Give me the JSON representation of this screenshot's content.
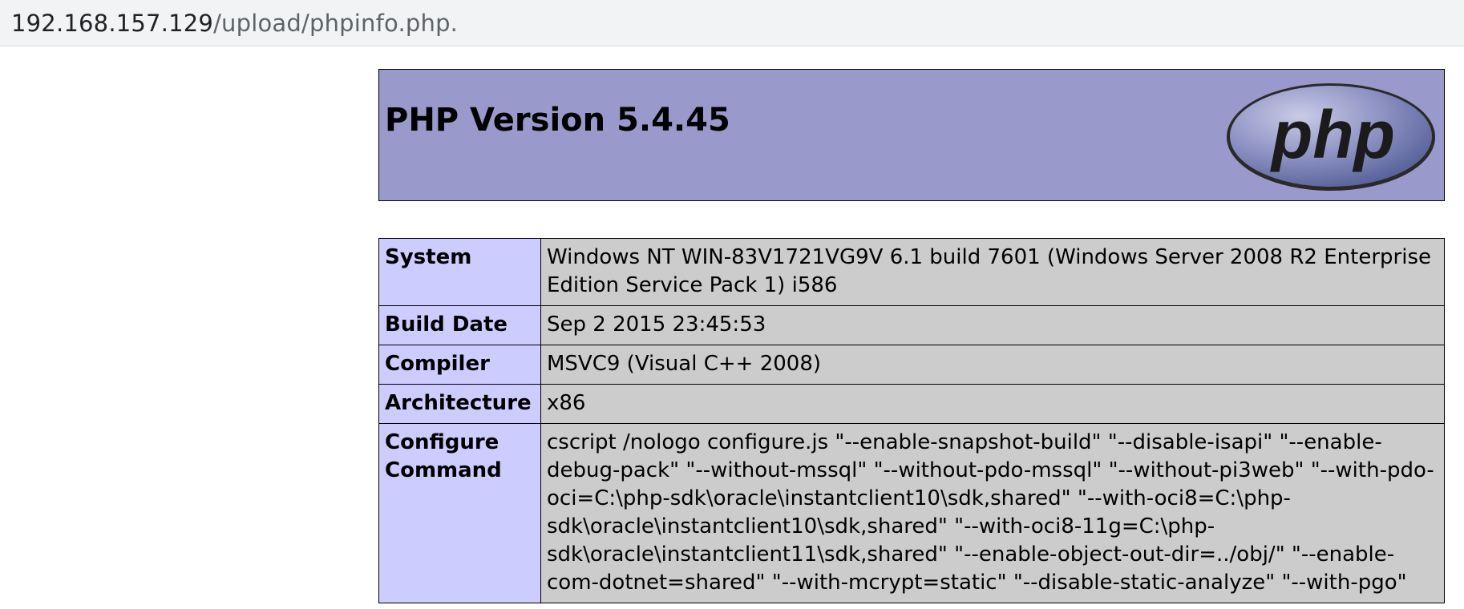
{
  "address_bar": {
    "host": "192.168.157.129",
    "path": "/upload/phpinfo.php."
  },
  "header": {
    "title": "PHP Version 5.4.45",
    "logo_text": "php"
  },
  "info_table": {
    "rows": [
      {
        "label": "System",
        "value": "Windows NT WIN-83V1721VG9V 6.1 build 7601 (Windows Server 2008 R2 Enterprise Edition Service Pack 1) i586"
      },
      {
        "label": "Build Date",
        "value": "Sep 2 2015 23:45:53"
      },
      {
        "label": "Compiler",
        "value": "MSVC9 (Visual C++ 2008)"
      },
      {
        "label": "Architecture",
        "value": "x86"
      },
      {
        "label": "Configure Command",
        "value": "cscript /nologo configure.js \"--enable-snapshot-build\" \"--disable-isapi\" \"--enable-debug-pack\" \"--without-mssql\" \"--without-pdo-mssql\" \"--without-pi3web\" \"--with-pdo-oci=C:\\php-sdk\\oracle\\instantclient10\\sdk,shared\" \"--with-oci8=C:\\php-sdk\\oracle\\instantclient10\\sdk,shared\" \"--with-oci8-11g=C:\\php-sdk\\oracle\\instantclient11\\sdk,shared\" \"--enable-object-out-dir=../obj/\" \"--enable-com-dotnet=shared\" \"--with-mcrypt=static\" \"--disable-static-analyze\" \"--with-pgo\""
      }
    ]
  },
  "colors": {
    "header_bg": "#9999cc",
    "label_bg": "#ccccff",
    "value_bg": "#cccccc",
    "logo_fill": "#777bb3"
  }
}
